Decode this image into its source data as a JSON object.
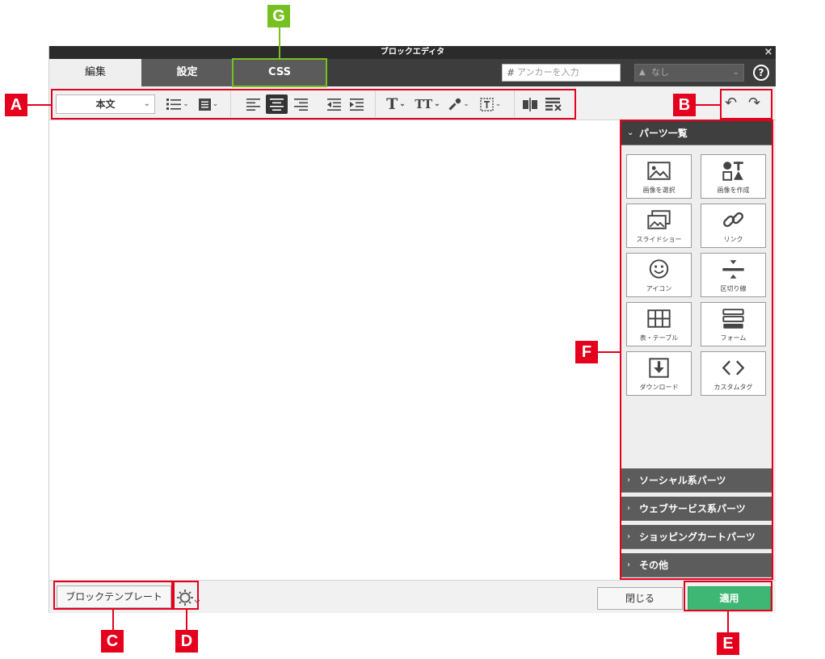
{
  "window": {
    "title": "ブロックエディタ",
    "close_glyph": "×"
  },
  "tabs": {
    "edit": "編集",
    "settings": "設定",
    "css": "CSS"
  },
  "anchor": {
    "hash": "#",
    "placeholder": "アンカーを入力",
    "select_value": "なし",
    "help": "?"
  },
  "toolbar": {
    "style_select": "本文",
    "undo": "↶",
    "redo": "↷"
  },
  "parts": {
    "header": "パーツ一覧",
    "items": [
      {
        "label": "画像を選択",
        "icon": "image-icon"
      },
      {
        "label": "画像を作成",
        "icon": "shapes-icon"
      },
      {
        "label": "スライドショー",
        "icon": "slideshow-icon"
      },
      {
        "label": "リンク",
        "icon": "link-icon"
      },
      {
        "label": "アイコン",
        "icon": "smiley-icon"
      },
      {
        "label": "区切り線",
        "icon": "divider-icon"
      },
      {
        "label": "表・テーブル",
        "icon": "table-icon"
      },
      {
        "label": "フォーム",
        "icon": "form-icon"
      },
      {
        "label": "ダウンロード",
        "icon": "download-icon"
      },
      {
        "label": "カスタムタグ",
        "icon": "code-icon"
      }
    ],
    "sections": [
      "ソーシャル系パーツ",
      "ウェブサービス系パーツ",
      "ショッピングカートパーツ",
      "その他"
    ]
  },
  "footer": {
    "template": "ブロックテンプレート",
    "close": "閉じる",
    "apply": "適用"
  },
  "annotations": {
    "a": "A",
    "b": "B",
    "c": "C",
    "d": "D",
    "e": "E",
    "f": "F",
    "g": "G"
  },
  "colors": {
    "highlight_red": "#e5001e",
    "highlight_green": "#77c022",
    "apply_green": "#3eb774"
  }
}
